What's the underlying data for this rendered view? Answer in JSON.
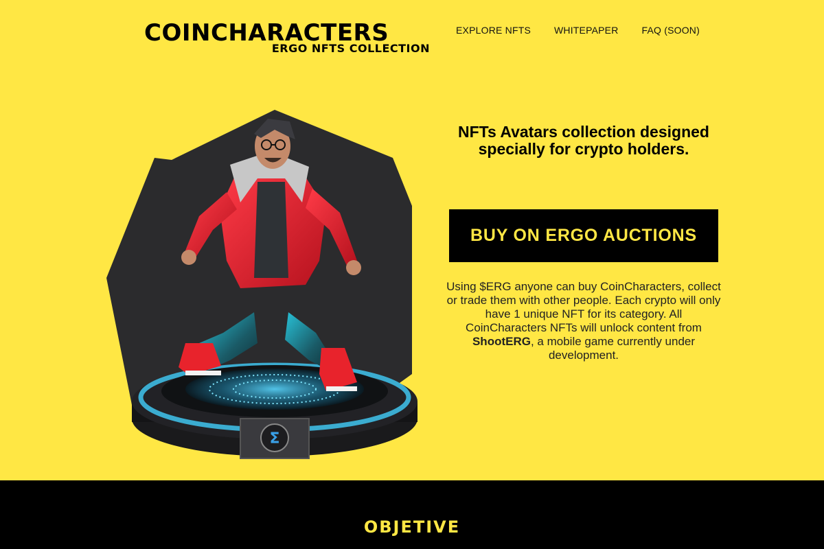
{
  "header": {
    "logo_main": "COINCHARACTERS",
    "logo_sub": "ERGO NFTS COLLECTION",
    "nav": [
      {
        "label": "EXPLORE NFTS"
      },
      {
        "label": "WHITEPAPER"
      },
      {
        "label": "FAQ (SOON)"
      }
    ]
  },
  "hero": {
    "headline": "NFTs Avatars collection designed specially for crypto holders.",
    "cta_label": "BUY ON ERGO AUCTIONS",
    "description_pre": "Using $ERG anyone can buy CoinCharacters, collect or trade them with other people. Each crypto will only have 1 unique NFT for its category. All CoinCharacters NFTs will unlock content from ",
    "description_bold": "ShootERG",
    "description_post": ", a mobile game currently under development.",
    "image_alt": "3D NFT avatar character crouching on a glowing pedestal"
  },
  "section": {
    "title": "OBJETIVE"
  },
  "colors": {
    "background": "#ffe744",
    "accent": "#ffe744",
    "dark": "#000000"
  }
}
